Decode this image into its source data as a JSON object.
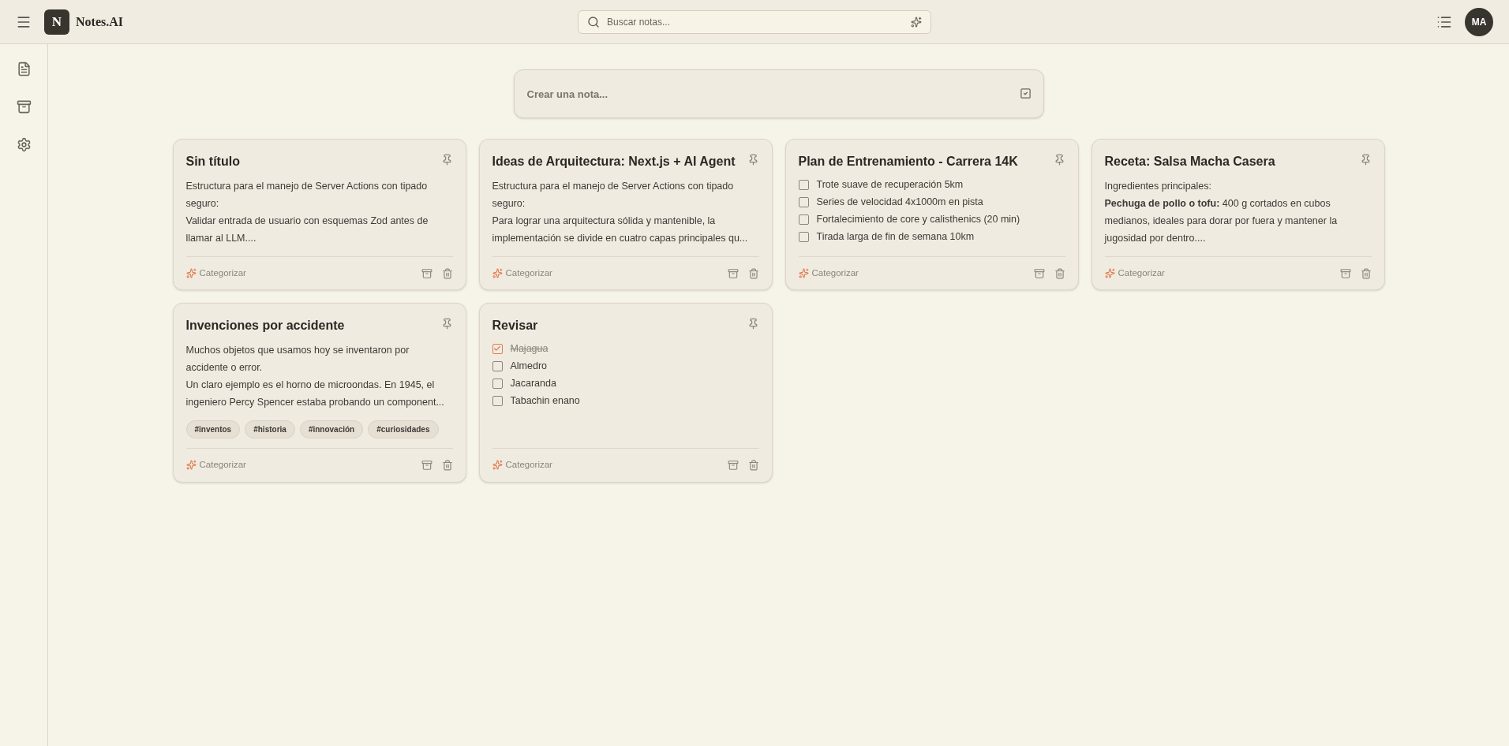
{
  "header": {
    "logo_letter": "N",
    "app_name": "Notes.AI",
    "search": {
      "placeholder": "Buscar notas..."
    },
    "avatar": "MA"
  },
  "sidebar": {
    "items": [
      {
        "kind": "notes",
        "selected": false
      },
      {
        "kind": "archive",
        "selected": false
      },
      {
        "kind": "settings",
        "selected": false
      }
    ]
  },
  "composer": {
    "placeholder": "Crear una nota..."
  },
  "notes": [
    {
      "kind": "text",
      "title": "Sin título",
      "lines": [
        "Estructura para el manejo de Server Actions con tipado seguro:",
        "Validar entrada de usuario con esquemas Zod antes de llamar al LLM...."
      ],
      "action": "Categorizar"
    },
    {
      "kind": "text",
      "title": "Ideas de Arquitectura: Next.js + AI Agent",
      "lines": [
        "Estructura para el manejo de Server Actions con tipado seguro:",
        "Para lograr una arquitectura sólida y mantenible, la implementación se divide en cuatro capas principales qu..."
      ],
      "action": "Categorizar"
    },
    {
      "kind": "checklist",
      "title": "Plan de Entrenamiento - Carrera 14K",
      "items": [
        {
          "text": "Trote suave de recuperación 5km",
          "checked": false
        },
        {
          "text": "Series de velocidad 4x1000m en pista",
          "checked": false
        },
        {
          "text": "Fortalecimiento de core y calisthenics (20 min)",
          "checked": false
        },
        {
          "text": "Tirada larga de fin de semana 10km",
          "checked": false
        }
      ],
      "action": "Categorizar"
    },
    {
      "kind": "text",
      "title": "Receta: Salsa Macha Casera",
      "lines": [
        "Ingredientes principales:",
        "**Pechuga de pollo o tofu:** 400 g cortados en cubos medianos, ideales para dorar por fuera y mantener la jugosidad por dentro...."
      ],
      "action": "Categorizar"
    },
    {
      "kind": "text",
      "title": "Invenciones por accidente",
      "lines": [
        "Muchos objetos que usamos hoy se inventaron por accidente o error.",
        "Un claro ejemplo es el horno de microondas. En 1945, el ingeniero Percy Spencer estaba probando un component..."
      ],
      "tags": [
        "#inventos",
        "#historia",
        "#innovación",
        "#curiosidades"
      ],
      "action": "Categorizar"
    },
    {
      "kind": "checklist",
      "title": "Revisar",
      "items": [
        {
          "text": "Majagua",
          "checked": true
        },
        {
          "text": "Almedro",
          "checked": false
        },
        {
          "text": "Jacaranda",
          "checked": false
        },
        {
          "text": "Tabachin enano",
          "checked": false
        }
      ],
      "action": "Categorizar"
    }
  ]
}
